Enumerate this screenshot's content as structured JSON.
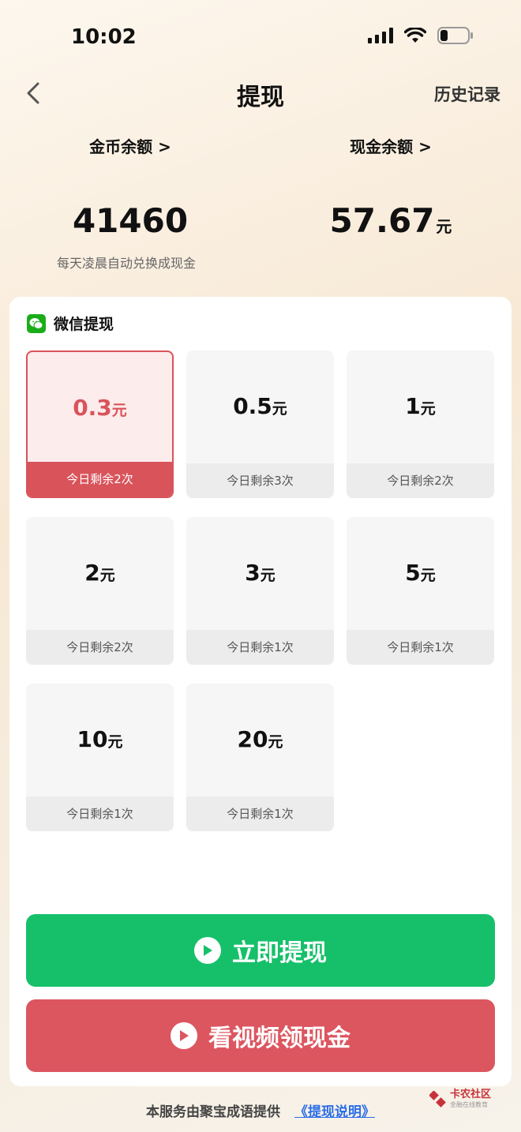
{
  "status": {
    "time": "10:02"
  },
  "nav": {
    "title": "提现",
    "history": "历史记录"
  },
  "balance": {
    "coin_label": "金币余额 >",
    "coin_value": "41460",
    "cash_label": "现金余额 >",
    "cash_value": "57.67",
    "cash_unit": "元",
    "note": "每天凌晨自动兑换成现金"
  },
  "withdraw": {
    "title": "微信提现",
    "unit": "元",
    "options": [
      {
        "amount": "0.3",
        "remain": "今日剩余2次",
        "selected": true
      },
      {
        "amount": "0.5",
        "remain": "今日剩余3次",
        "selected": false
      },
      {
        "amount": "1",
        "remain": "今日剩余2次",
        "selected": false
      },
      {
        "amount": "2",
        "remain": "今日剩余2次",
        "selected": false
      },
      {
        "amount": "3",
        "remain": "今日剩余1次",
        "selected": false
      },
      {
        "amount": "5",
        "remain": "今日剩余1次",
        "selected": false
      },
      {
        "amount": "10",
        "remain": "今日剩余1次",
        "selected": false
      },
      {
        "amount": "20",
        "remain": "今日剩余1次",
        "selected": false
      }
    ]
  },
  "buttons": {
    "withdraw_now": "立即提现",
    "watch_video": "看视频领现金"
  },
  "footer": {
    "text": "本服务由聚宝成语提供",
    "link": "《提现说明》"
  },
  "watermark": {
    "name": "卡农社区",
    "sub": "金融在线教育"
  },
  "colors": {
    "selected": "#d9535b",
    "green": "#16c06a",
    "red": "#dc5660",
    "wechat": "#1aad19",
    "link": "#2a6ee8"
  }
}
